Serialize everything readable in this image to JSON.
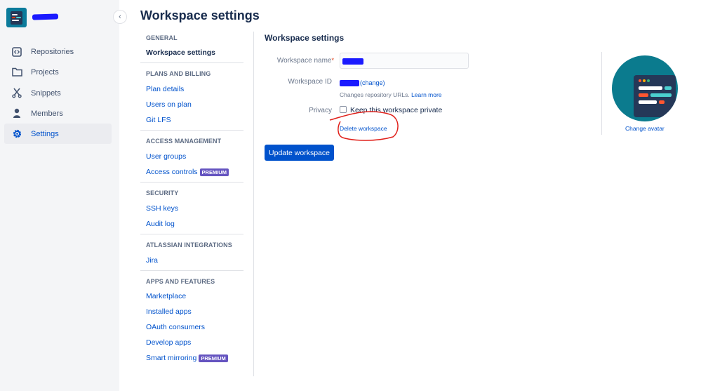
{
  "page": {
    "title": "Workspace settings"
  },
  "global_nav": {
    "collapse_icon": "chevron-left-icon",
    "items": [
      {
        "label": "Repositories",
        "icon": "repository-icon",
        "active": false
      },
      {
        "label": "Projects",
        "icon": "folder-icon",
        "active": false
      },
      {
        "label": "Snippets",
        "icon": "scissors-icon",
        "active": false
      },
      {
        "label": "Members",
        "icon": "person-icon",
        "active": false
      },
      {
        "label": "Settings",
        "icon": "gear-icon",
        "active": true
      }
    ]
  },
  "settings_nav": {
    "sections": [
      {
        "heading": "GENERAL",
        "links": [
          {
            "label": "Workspace settings",
            "current": true
          }
        ]
      },
      {
        "heading": "PLANS AND BILLING",
        "links": [
          {
            "label": "Plan details"
          },
          {
            "label": "Users on plan"
          },
          {
            "label": "Git LFS"
          }
        ]
      },
      {
        "heading": "ACCESS MANAGEMENT",
        "links": [
          {
            "label": "User groups"
          },
          {
            "label": "Access controls",
            "badge": "PREMIUM"
          }
        ]
      },
      {
        "heading": "SECURITY",
        "links": [
          {
            "label": "SSH keys"
          },
          {
            "label": "Audit log"
          }
        ]
      },
      {
        "heading": "ATLASSIAN INTEGRATIONS",
        "links": [
          {
            "label": "Jira"
          }
        ]
      },
      {
        "heading": "APPS AND FEATURES",
        "links": [
          {
            "label": "Marketplace"
          },
          {
            "label": "Installed apps"
          },
          {
            "label": "OAuth consumers"
          },
          {
            "label": "Develop apps"
          },
          {
            "label": "Smart mirroring",
            "badge": "PREMIUM"
          }
        ]
      }
    ]
  },
  "form": {
    "title": "Workspace settings",
    "name_label": "Workspace name",
    "required_mark": "*",
    "id_label": "Workspace ID",
    "change_link": "(change)",
    "help_text": "Changes repository URLs.",
    "learn_more": "Learn more",
    "privacy_label": "Privacy",
    "private_checkbox_label": "Keep this workspace private",
    "private_checked": false,
    "delete_link": "Delete workspace",
    "update_button": "Update workspace"
  },
  "avatar": {
    "change_label": "Change avatar"
  },
  "colors": {
    "link": "#0052cc",
    "primary_button": "#0052cc",
    "premium_badge": "#6554c0",
    "annotation": "#e0201a",
    "redaction": "#1a1aff"
  }
}
